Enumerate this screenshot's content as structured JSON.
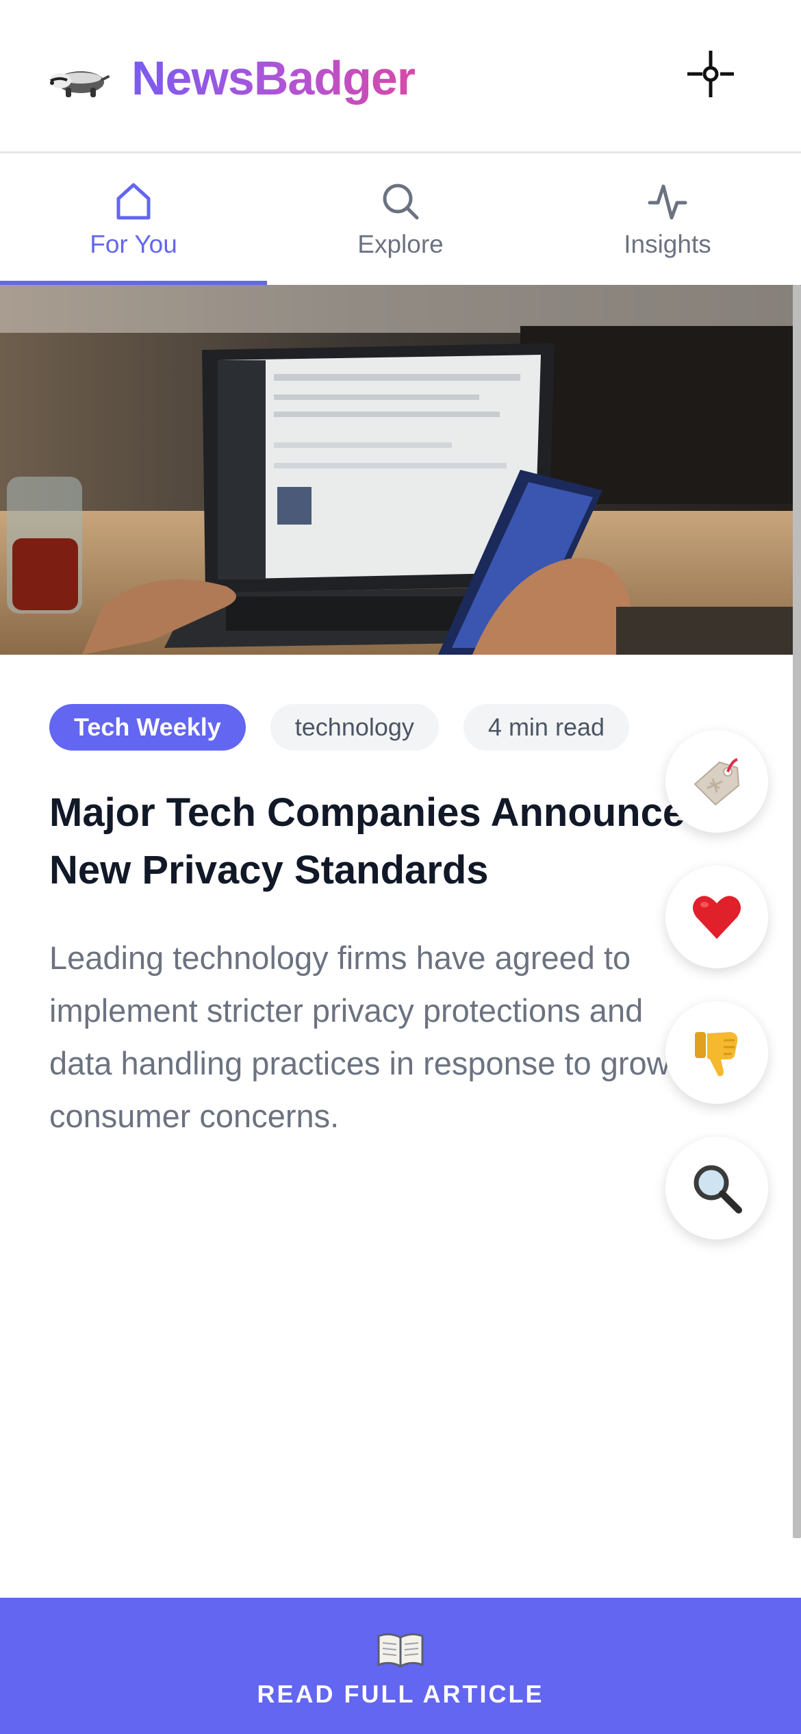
{
  "app": {
    "title": "NewsBadger",
    "brand_gradient": [
      "#7a5cf0",
      "#d64aa8"
    ],
    "accent": "#6366f1",
    "logo_icon": "badger-icon",
    "header_action_icon": "focus-target-icon"
  },
  "tabs": [
    {
      "label": "For You",
      "icon": "home-icon",
      "active": true
    },
    {
      "label": "Explore",
      "icon": "search-icon",
      "active": false
    },
    {
      "label": "Insights",
      "icon": "activity-icon",
      "active": false
    }
  ],
  "article": {
    "image": "photo: person using laptop and smartphone at desk",
    "source": "Tech Weekly",
    "category": "technology",
    "read_time": "4 min read",
    "headline_lines": [
      "Major Tech Companies Announce",
      "New Privacy Standards"
    ],
    "summary_lines": [
      "Leading technology firms have agreed to",
      "implement stricter privacy protections and",
      "data handling practices in response to growing",
      "consumer concerns."
    ]
  },
  "actions": [
    {
      "name": "save",
      "icon": "tag-icon"
    },
    {
      "name": "like",
      "icon": "heart-icon"
    },
    {
      "name": "dislike",
      "icon": "thumbs-down-icon"
    },
    {
      "name": "search",
      "icon": "magnifier-icon"
    }
  ],
  "cta": {
    "label": "READ FULL ARTICLE",
    "icon": "open-book-icon"
  }
}
